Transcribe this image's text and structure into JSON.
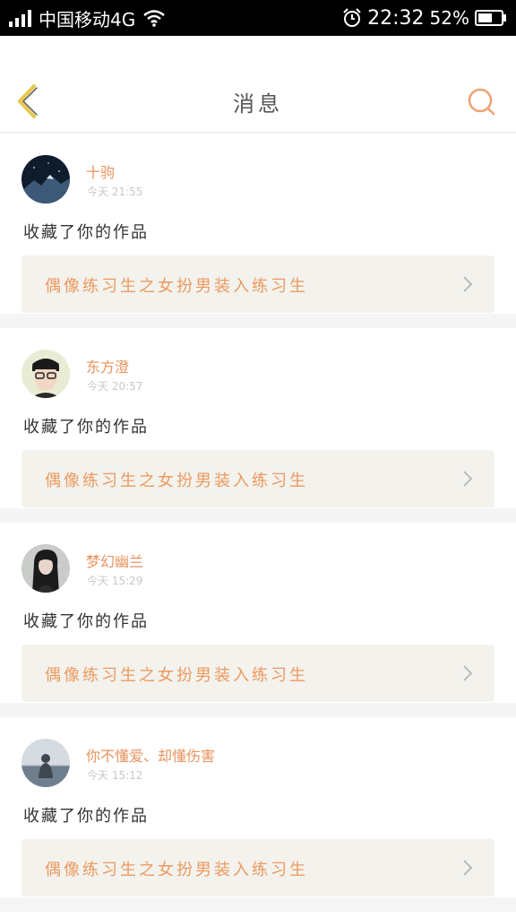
{
  "status_bar": {
    "carrier": "中国移动4G",
    "time": "22:32",
    "battery": "52%"
  },
  "nav": {
    "title": "消息"
  },
  "colors": {
    "accent": "#e8935c",
    "back_icon": "#e6c84a",
    "card_box": "#f3f2ed"
  },
  "messages": [
    {
      "user": "十驹",
      "time": "今天 21:55",
      "action": "收藏了你的作品",
      "work": "偶像练习生之女扮男装入练习生",
      "avatar": "mountain-night-avatar"
    },
    {
      "user": "东方澄",
      "time": "今天 20:57",
      "action": "收藏了你的作品",
      "work": "偶像练习生之女扮男装入练习生",
      "avatar": "man-with-glasses-avatar"
    },
    {
      "user": "梦幻幽兰",
      "time": "今天 15:29",
      "action": "收藏了你的作品",
      "work": "偶像练习生之女扮男装入练习生",
      "avatar": "woman-portrait-avatar"
    },
    {
      "user": "你不懂爱、却懂伤害",
      "time": "今天 15:12",
      "action": "收藏了你的作品",
      "work": "偶像练习生之女扮男装入练习生",
      "avatar": "person-sitting-sea-avatar"
    }
  ]
}
